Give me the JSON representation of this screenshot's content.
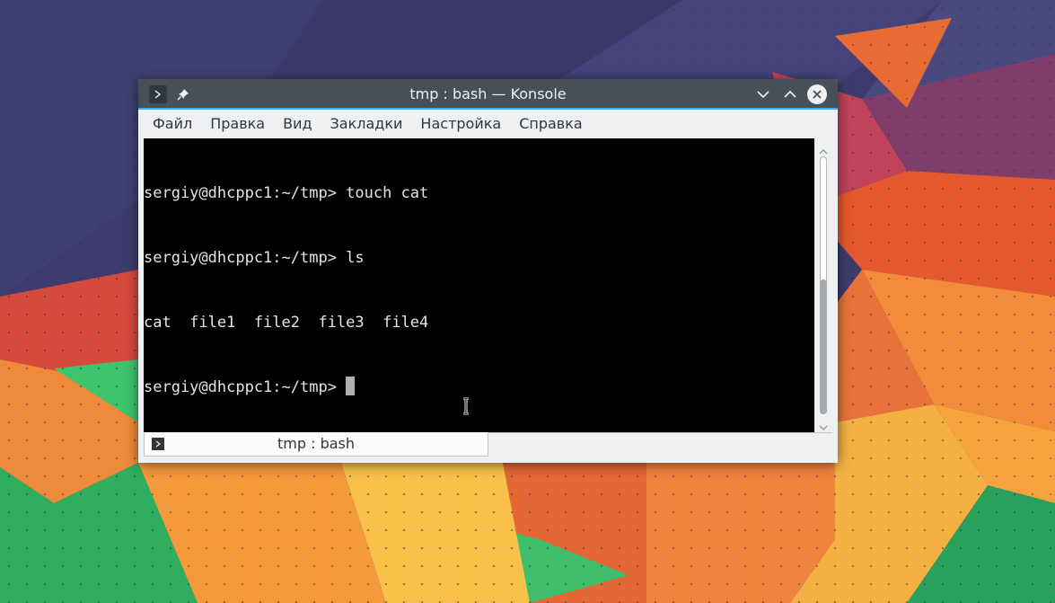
{
  "window": {
    "title": "tmp : bash — Konsole"
  },
  "menu": [
    "Файл",
    "Правка",
    "Вид",
    "Закладки",
    "Настройка",
    "Справка"
  ],
  "terminal": {
    "lines": [
      "sergiy@dhcppc1:~/tmp> touch cat",
      "sergiy@dhcppc1:~/tmp> ls",
      "cat  file1  file2  file3  file4"
    ],
    "prompt": "sergiy@dhcppc1:~/tmp> "
  },
  "tabs": [
    {
      "label": "tmp : bash"
    }
  ],
  "icons": {
    "app": "terminal-icon",
    "pin": "pin-icon",
    "minimize": "chevron-down-icon",
    "maximize": "chevron-up-icon",
    "close": "close-icon",
    "pointer": "text-cursor-icon"
  },
  "colors": {
    "accent": "#3daee9",
    "titlebar": "#475057",
    "terminal_bg": "#000000",
    "terminal_fg": "#e4e4e4"
  }
}
